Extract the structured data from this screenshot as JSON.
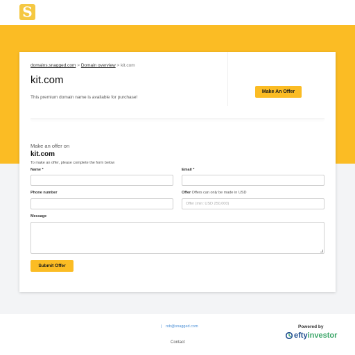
{
  "header": {
    "logo_letter": "S"
  },
  "breadcrumb": {
    "items": [
      "domains.snagged.com",
      "Domain overview"
    ],
    "separator": ">",
    "current": "kit.com"
  },
  "domain": {
    "name": "kit.com",
    "availability": "This premium domain name is available for purchase!"
  },
  "make_offer_button": "Make An Offer",
  "offer_form": {
    "heading": "Make an offer on",
    "domain": "kit.com",
    "instructions": "To make an offer, please complete the form below",
    "name_label": "Name *",
    "email_label": "Email *",
    "phone_label": "Phone number",
    "offer_label": "Offer",
    "offer_note": "Offers can only be made in USD",
    "offer_placeholder": "Offer (min: USD 250,000)",
    "message_label": "Message",
    "submit_label": "Submit Offer"
  },
  "footer": {
    "email": "rob@snagged.com",
    "contact": "Contact",
    "powered_by": "Powered by",
    "brand_part1": "efty",
    "brand_part2": "investor"
  },
  "colors": {
    "accent": "#fbbc24",
    "link": "#4a8fd6",
    "brand_blue": "#1f4d8f",
    "brand_green": "#3aa567"
  }
}
